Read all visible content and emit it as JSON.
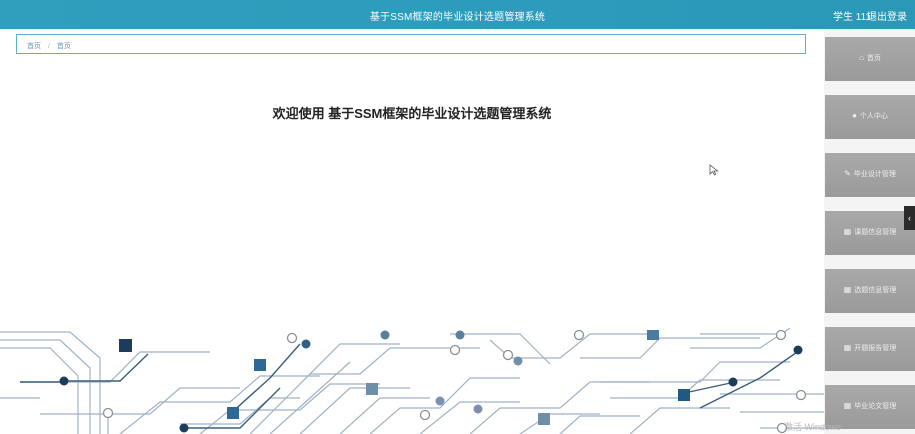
{
  "header": {
    "title": "基于SSM框架的毕业设计选题管理系统",
    "user": "学生 111",
    "logout": "退出登录"
  },
  "breadcrumb": {
    "items": [
      "首页",
      "首页"
    ],
    "separator": "/"
  },
  "main": {
    "welcome": "欢迎使用 基于SSM框架的毕业设计选题管理系统"
  },
  "sidebar": {
    "items": [
      {
        "label": "首页",
        "icon": "home-icon"
      },
      {
        "label": "个人中心",
        "icon": "person-icon"
      },
      {
        "label": "毕业设计管理",
        "icon": "doc-icon"
      },
      {
        "label": "课题信息管理",
        "icon": "grid-icon"
      },
      {
        "label": "选题信息管理",
        "icon": "grid-icon"
      },
      {
        "label": "开题报告管理",
        "icon": "grid-icon"
      },
      {
        "label": "毕业论文管理",
        "icon": "grid-icon"
      }
    ],
    "toggle_icon": "chevron-left-icon"
  },
  "watermark": "激活 Windows",
  "colors": {
    "topbar": "#2b9cbc",
    "breadcrumb_border": "#5fb0c9",
    "sidebar_item": "#a3a3a3",
    "circuit_dark": "#1d3c5c",
    "circuit_mid": "#3d6f94",
    "circuit_light": "#9db3c7"
  }
}
